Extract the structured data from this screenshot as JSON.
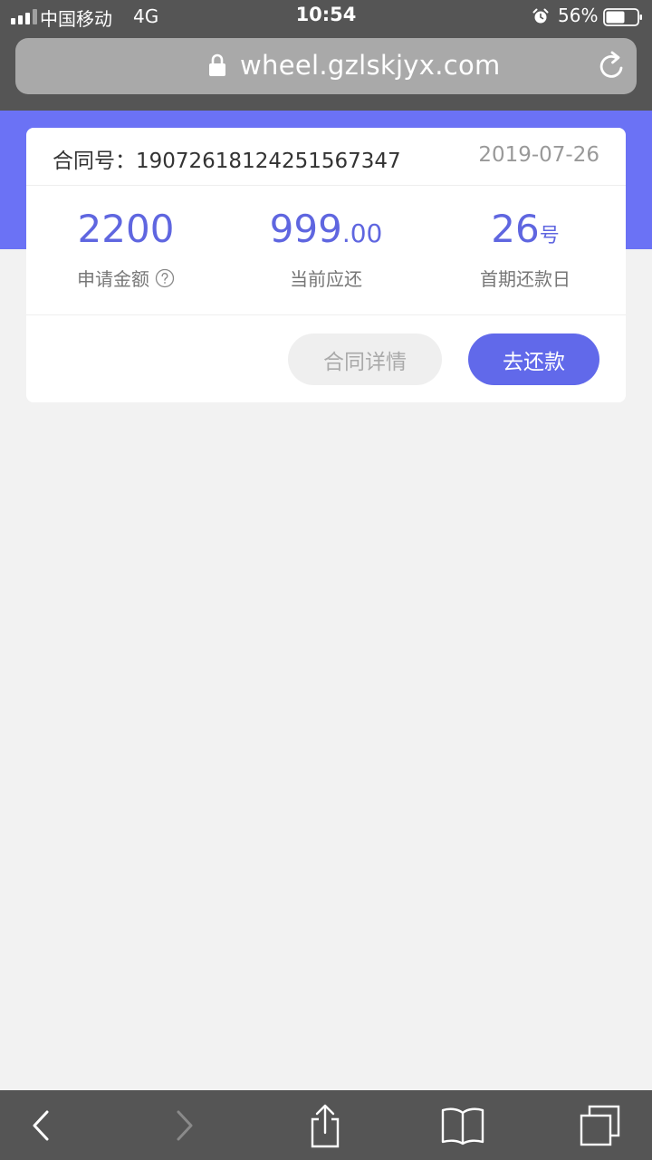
{
  "status_bar": {
    "carrier": "中国移动",
    "network": "4G",
    "time": "10:54",
    "battery": "56%",
    "icons": [
      "signal-icon",
      "alarm-icon",
      "battery-icon"
    ]
  },
  "browser": {
    "url": "wheel.gzlskjyx.com",
    "icons": [
      "lock-icon",
      "reload-icon"
    ]
  },
  "card": {
    "contract_label": "合同号：19072618124251567347",
    "date": "2019-07-26",
    "stats": [
      {
        "value": "2200",
        "label": "申请金额"
      },
      {
        "value_main": "999",
        "value_fraction": ".00",
        "label": "当前应还"
      },
      {
        "value": "26",
        "unit": "号",
        "label": "首期还款日"
      }
    ],
    "buttons": {
      "detail": "合同详情",
      "repay": "去还款"
    }
  },
  "toolbar": {
    "icons": [
      "back-icon",
      "forward-icon",
      "share-icon",
      "bookmarks-icon",
      "tabs-icon"
    ]
  },
  "colors": {
    "accent": "#6169ea",
    "banner": "#6b72f5",
    "chrome": "#555555",
    "background": "#f2f2f2"
  }
}
